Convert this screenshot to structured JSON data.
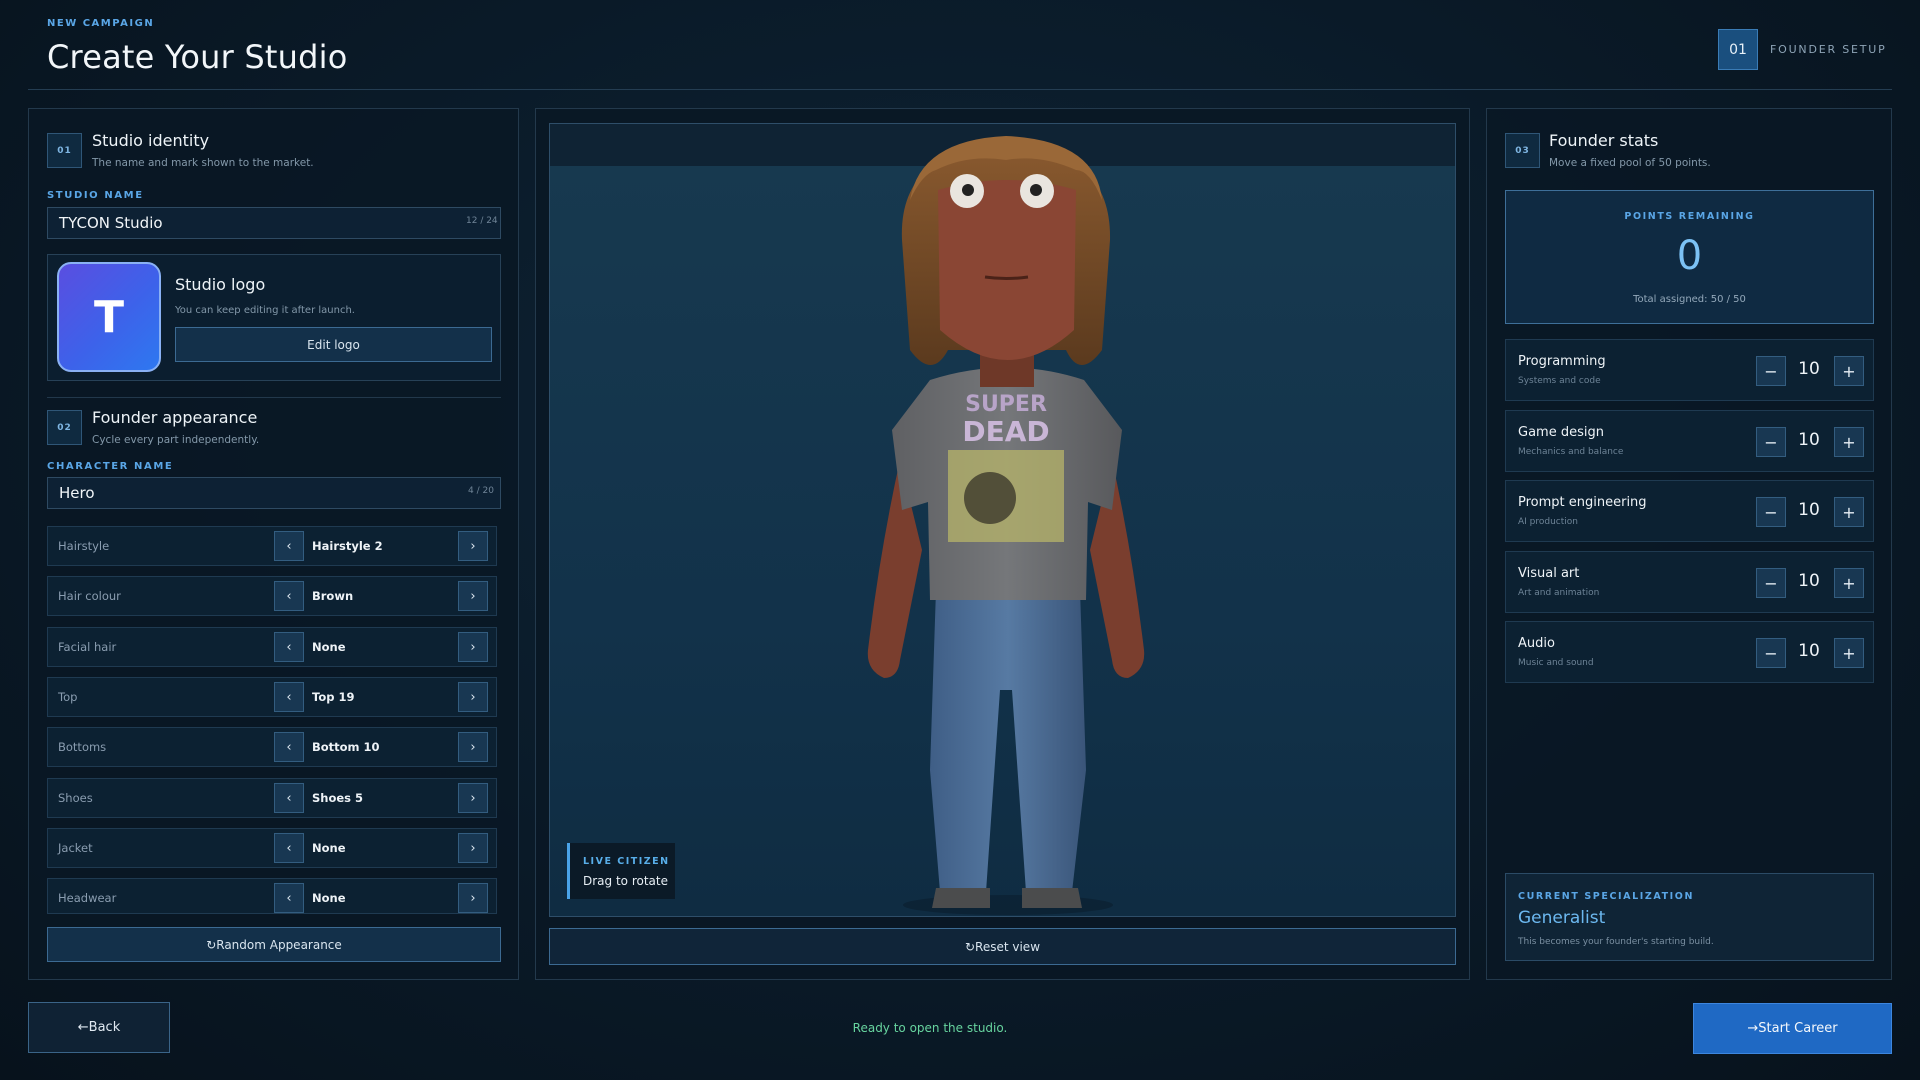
{
  "header": {
    "eyebrow": "NEW CAMPAIGN",
    "title": "Create Your Studio",
    "step_number": "01",
    "step_label": "FOUNDER SETUP"
  },
  "identity": {
    "badge": "01",
    "title": "Studio identity",
    "subtitle": "The name and mark shown to the market.",
    "name_label": "STUDIO NAME",
    "name_value": "TYCON Studio",
    "name_counter": "12 / 24",
    "logo_letter": "T",
    "logo_title": "Studio logo",
    "logo_subtitle": "You can keep editing it after launch.",
    "edit_logo_label": "Edit logo"
  },
  "appearance": {
    "badge": "02",
    "title": "Founder appearance",
    "subtitle": "Cycle every part independently.",
    "char_label": "CHARACTER NAME",
    "char_value": "Hero",
    "char_counter": "4 / 20",
    "prev_glyph": "‹",
    "next_glyph": "›",
    "rows": [
      {
        "label": "Hairstyle",
        "value": "Hairstyle 2"
      },
      {
        "label": "Hair colour",
        "value": "Brown"
      },
      {
        "label": "Facial hair",
        "value": "None"
      },
      {
        "label": "Top",
        "value": "Top 19"
      },
      {
        "label": "Bottoms",
        "value": "Bottom 10"
      },
      {
        "label": "Shoes",
        "value": "Shoes 5"
      },
      {
        "label": "Jacket",
        "value": "None"
      },
      {
        "label": "Headwear",
        "value": "None"
      }
    ],
    "random_label": "↻Random Appearance"
  },
  "viewport": {
    "shirt_text_1": "SUPER",
    "shirt_text_2": "DEAD",
    "live_title": "LIVE CITIZEN",
    "live_hint": "Drag to rotate",
    "reset_label": "↻Reset view"
  },
  "stats": {
    "badge": "03",
    "title": "Founder stats",
    "subtitle": "Move a fixed pool of 50 points.",
    "points_label": "POINTS REMAINING",
    "points_value": "0",
    "total_assigned": "Total assigned: 50 / 50",
    "minus_glyph": "−",
    "plus_glyph": "+",
    "rows": [
      {
        "name": "Programming",
        "desc": "Systems and code",
        "value": "10"
      },
      {
        "name": "Game design",
        "desc": "Mechanics and balance",
        "value": "10"
      },
      {
        "name": "Prompt engineering",
        "desc": "AI production",
        "value": "10"
      },
      {
        "name": "Visual art",
        "desc": "Art and animation",
        "value": "10"
      },
      {
        "name": "Audio",
        "desc": "Music and sound",
        "value": "10"
      }
    ],
    "spec_label": "CURRENT SPECIALIZATION",
    "spec_value": "Generalist",
    "spec_desc": "This becomes your founder's starting build."
  },
  "footer": {
    "back_label": "←Back",
    "status": "Ready to open the studio.",
    "start_label": "→Start Career"
  },
  "colors": {
    "accent": "#5aa6e6",
    "primary_button": "#1f69c4",
    "status_ok": "#67d49f",
    "background": "#0a1a28"
  },
  "icons": [
    "chevron-left-icon",
    "chevron-right-icon",
    "refresh-icon",
    "arrow-left-icon",
    "arrow-right-icon",
    "minus-icon",
    "plus-icon"
  ]
}
